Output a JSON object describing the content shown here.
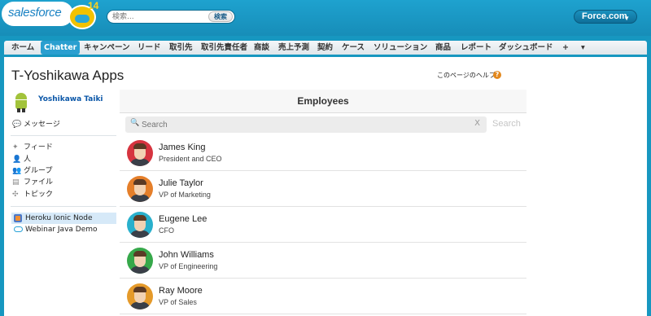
{
  "header": {
    "logo_text": "salesforce",
    "logo_release": "14",
    "search_placeholder": "検索...",
    "search_button": "検索",
    "app_switcher": "Force.com"
  },
  "tabs": [
    {
      "label": "ホーム",
      "active": false
    },
    {
      "label": "Chatter",
      "active": true
    },
    {
      "label": "キャンペーン",
      "active": false
    },
    {
      "label": "リード",
      "active": false
    },
    {
      "label": "取引先",
      "active": false
    },
    {
      "label": "取引先責任者",
      "active": false
    },
    {
      "label": "商談",
      "active": false
    },
    {
      "label": "売上予測",
      "active": false
    },
    {
      "label": "契約",
      "active": false
    },
    {
      "label": "ケース",
      "active": false
    },
    {
      "label": "ソリューション",
      "active": false
    },
    {
      "label": "商品",
      "active": false
    },
    {
      "label": "レポート",
      "active": false
    },
    {
      "label": "ダッシュボード",
      "active": false
    },
    {
      "label": "+",
      "active": false
    },
    {
      "label": "▾",
      "active": false
    }
  ],
  "page": {
    "title": "T-Yoshikawa Apps",
    "help_link": "このページのヘルプ",
    "help_icon": "?"
  },
  "sidebar": {
    "user_name": "Yoshikawa Taiki",
    "messages_label": "メッセージ",
    "nav": [
      {
        "label": "フィード",
        "icon": "feed-icon"
      },
      {
        "label": "人",
        "icon": "person-icon"
      },
      {
        "label": "グループ",
        "icon": "group-icon"
      },
      {
        "label": "ファイル",
        "icon": "file-icon"
      },
      {
        "label": "トピック",
        "icon": "topic-icon"
      }
    ],
    "apps": [
      {
        "label": "Heroku Ionic Node",
        "icon": "app-grid-icon",
        "selected": true
      },
      {
        "label": "Webinar Java Demo",
        "icon": "cloud-icon",
        "selected": false
      }
    ]
  },
  "employees_panel": {
    "header": "Employees",
    "search_placeholder": "Search",
    "clear_label": "X",
    "cancel_label": "Search",
    "employees": [
      {
        "name": "James King",
        "title": "President and CEO",
        "ring_color": "#d6343f"
      },
      {
        "name": "Julie Taylor",
        "title": "VP of Marketing",
        "ring_color": "#e57f2a"
      },
      {
        "name": "Eugene Lee",
        "title": "CFO",
        "ring_color": "#29b0cc"
      },
      {
        "name": "John Williams",
        "title": "VP of Engineering",
        "ring_color": "#36a84a"
      },
      {
        "name": "Ray Moore",
        "title": "VP of Sales",
        "ring_color": "#e59a2a"
      }
    ]
  },
  "colors": {
    "brand_blue": "#1797c0",
    "active_tab": "#2a9fd0",
    "link_blue": "#0b57a8",
    "selected_row": "#d6e9f8"
  }
}
